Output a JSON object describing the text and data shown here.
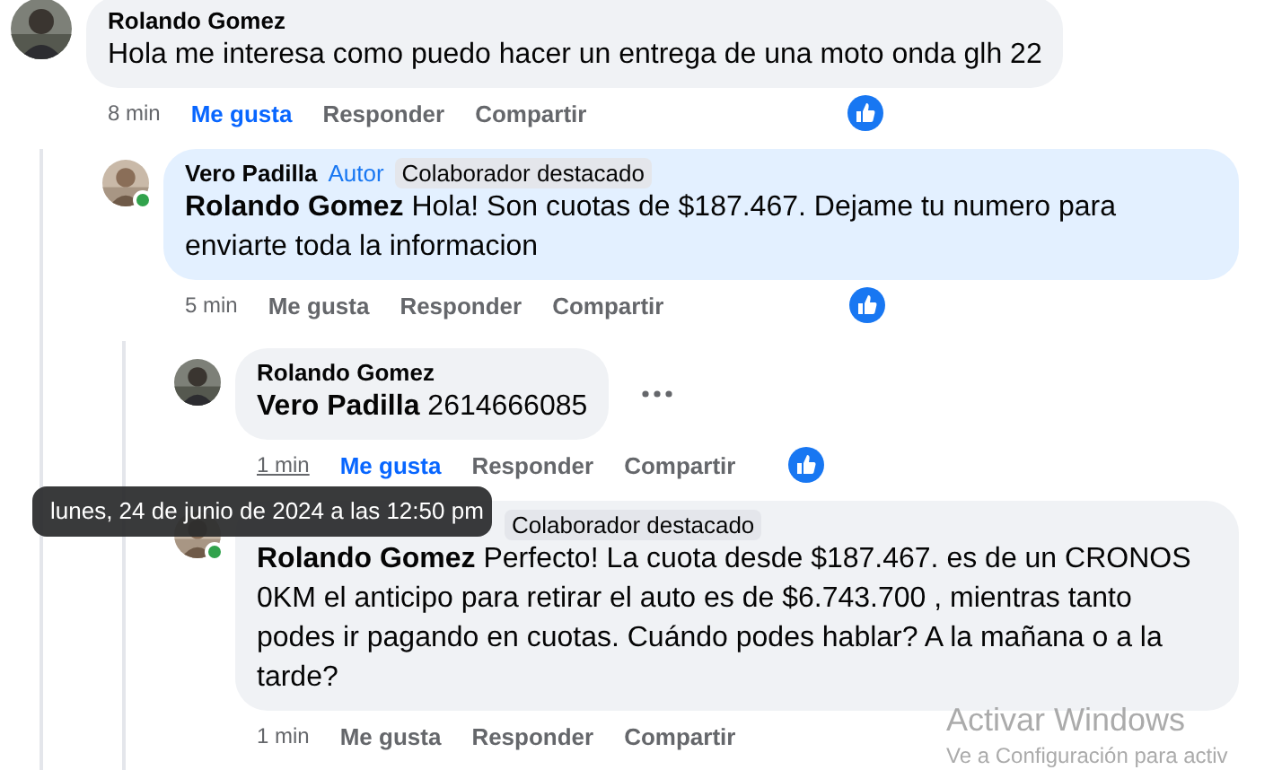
{
  "comments": [
    {
      "author": "Rolando Gomez",
      "online": false,
      "highlighted": false,
      "text": "Hola me interesa como puedo hacer un entrega de una moto onda glh 22",
      "time": "8 min",
      "time_hovered": false,
      "like_selected": true,
      "actions": [
        "Me gusta",
        "Responder",
        "Compartir"
      ],
      "reaction": true,
      "more_menu": false,
      "children": [
        {
          "author": "Vero Padilla",
          "online": true,
          "badges": [
            {
              "label": "Autor",
              "kind": "role"
            },
            {
              "label": "Colaborador destacado",
              "kind": "highlight"
            }
          ],
          "highlighted": true,
          "text": "**Rolando Gomez** Hola! Son cuotas de $187.467. Dejame tu numero para enviarte toda la informacion",
          "time": "5 min",
          "time_hovered": false,
          "like_selected": false,
          "actions": [
            "Me gusta",
            "Responder",
            "Compartir"
          ],
          "reaction": true,
          "more_menu": false,
          "children": [
            {
              "author": "Rolando Gomez",
              "online": false,
              "highlighted": false,
              "text": "**Vero Padilla** 2614666085",
              "time": "1 min",
              "time_hovered": true,
              "like_selected": true,
              "actions": [
                "Me gusta",
                "Responder",
                "Compartir"
              ],
              "reaction": true,
              "more_menu": true
            },
            {
              "online": true,
              "highlighted": false,
              "badges": [
                {
                  "label": "Colaborador destacado",
                  "kind": "highlight"
                }
              ],
              "text": "**Rolando Gomez** Perfecto! La cuota desde $187.467. es de un CRONOS 0KM el anticipo para retirar el auto es de $6.743.700 , mientras tanto podes ir pagando en cuotas. Cuándo podes hablar? A la mañana o a la tarde?",
              "time": "1 min",
              "time_hovered": false,
              "like_selected": false,
              "actions": [
                "Me gusta",
                "Responder",
                "Compartir"
              ],
              "reaction": false,
              "more_menu": false
            }
          ]
        }
      ]
    }
  ],
  "tooltip": {
    "text": "lunes, 24 de junio de 2024 a las 12:50 pm"
  },
  "os_notice": {
    "title": "Activar Windows",
    "subtitle": "Ve a Configuración para activ"
  }
}
